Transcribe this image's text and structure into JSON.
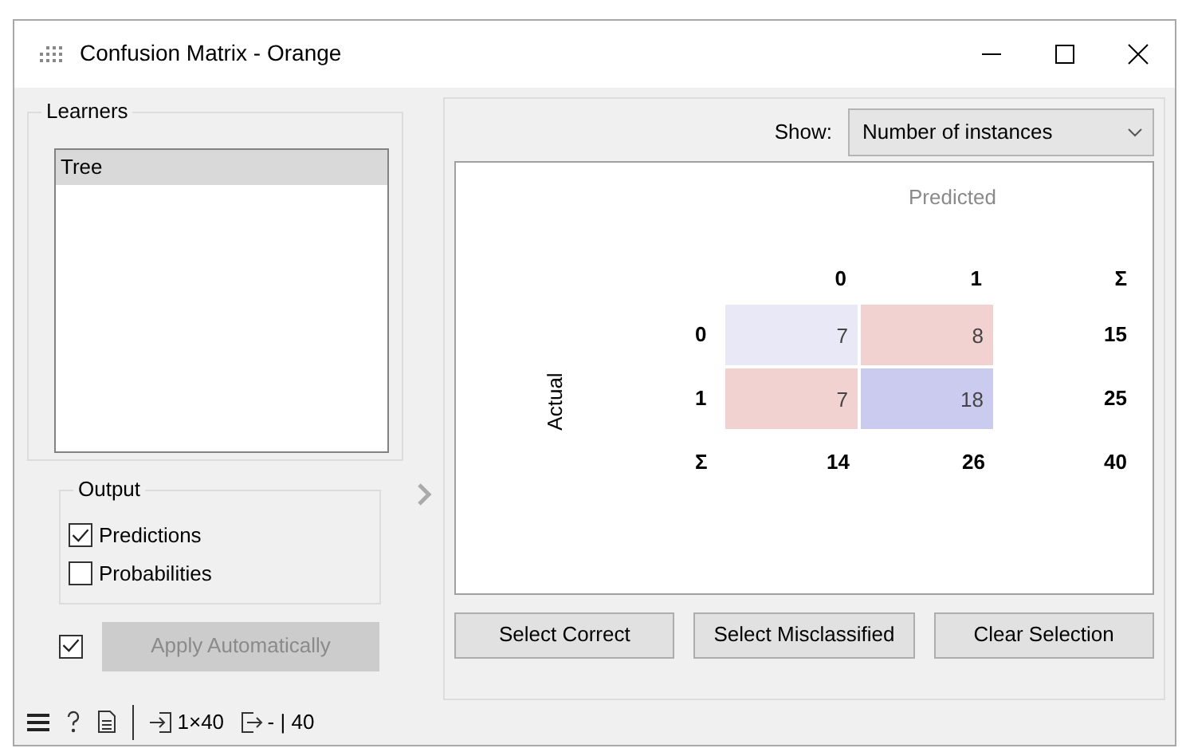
{
  "window": {
    "title": "Confusion Matrix - Orange"
  },
  "learners": {
    "title": "Learners",
    "items": [
      {
        "label": "Tree",
        "selected": true
      }
    ]
  },
  "output": {
    "title": "Output",
    "options": [
      {
        "label": "Predictions",
        "checked": true
      },
      {
        "label": "Probabilities",
        "checked": false
      }
    ]
  },
  "auto_apply": {
    "label": "Apply Automatically",
    "checked": true,
    "disabled": true
  },
  "show": {
    "label": "Show:",
    "value": "Number of instances"
  },
  "matrix": {
    "predicted_label": "Predicted",
    "actual_label": "Actual",
    "columns": [
      "0",
      "1",
      "Σ"
    ],
    "rows": [
      {
        "label": "0",
        "cells": [
          {
            "value": "7",
            "color": "#e9e8f7"
          },
          {
            "value": "8",
            "color": "#f2d1d1"
          }
        ],
        "total": "15"
      },
      {
        "label": "1",
        "cells": [
          {
            "value": "7",
            "color": "#f2d1d1"
          },
          {
            "value": "18",
            "color": "#cbcbf0"
          }
        ],
        "total": "25"
      }
    ],
    "totals_label": "Σ",
    "totals": [
      "14",
      "26",
      "40"
    ]
  },
  "buttons": [
    "Select Correct",
    "Select Misclassified",
    "Clear Selection"
  ],
  "status_bar": {
    "input": "1×40",
    "output": "- | 40"
  }
}
